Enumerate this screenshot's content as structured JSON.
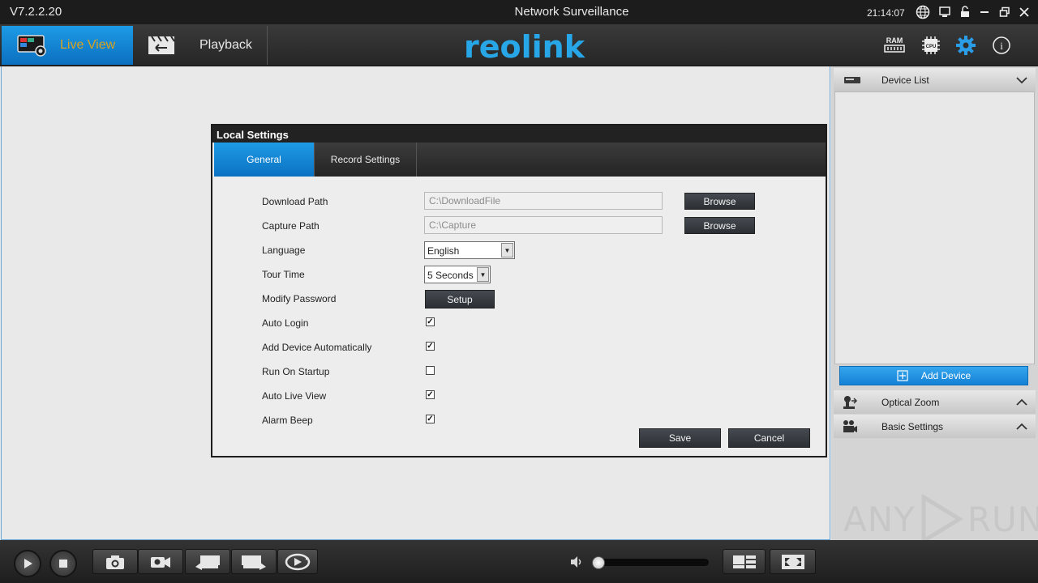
{
  "titlebar": {
    "version": "V7.2.2.20",
    "title": "Network Surveillance",
    "clock": "21:14:07"
  },
  "navbar": {
    "live_view_label": "Live View",
    "playback_label": "Playback",
    "logo": "reolink",
    "ram_label": "RAM",
    "cpu_label": "CPU",
    "info_glyph": "i"
  },
  "dialog": {
    "title": "Local Settings",
    "tabs": [
      {
        "label": "General",
        "active": true
      },
      {
        "label": "Record Settings",
        "active": false
      }
    ],
    "fields": {
      "download_path": {
        "label": "Download Path",
        "value": "C:\\DownloadFile",
        "button": "Browse"
      },
      "capture_path": {
        "label": "Capture Path",
        "value": "C:\\Capture",
        "button": "Browse"
      },
      "language": {
        "label": "Language",
        "value": "English"
      },
      "tour_time": {
        "label": "Tour Time",
        "value": "5 Seconds"
      },
      "modify_password": {
        "label": "Modify Password",
        "button": "Setup"
      }
    },
    "checkboxes": [
      {
        "label": "Auto Login",
        "checked": true
      },
      {
        "label": "Add Device Automatically",
        "checked": true
      },
      {
        "label": "Run On Startup",
        "checked": false
      },
      {
        "label": "Auto Live View",
        "checked": true
      },
      {
        "label": "Alarm Beep",
        "checked": true
      }
    ],
    "save_label": "Save",
    "cancel_label": "Cancel"
  },
  "right_panel": {
    "device_list": "Device List",
    "add_device": "Add Device",
    "optical_zoom": "Optical Zoom",
    "basic_settings": "Basic Settings"
  },
  "bottombar": {
    "volume_level": 0.03
  },
  "watermark": {
    "left": "ANY",
    "right": "RUN"
  },
  "colors": {
    "accent": "#1a8fe0",
    "live_view_text": "#d8a31e",
    "logo": "#27a7e8"
  }
}
